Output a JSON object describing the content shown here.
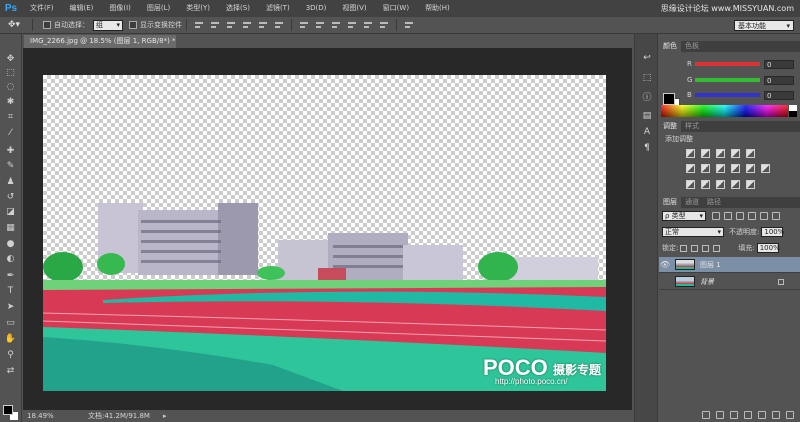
{
  "app": {
    "logo": "Ps",
    "accent": "#31a8ff"
  },
  "menu": {
    "items": [
      "文件(F)",
      "编辑(E)",
      "图像(I)",
      "图层(L)",
      "类型(Y)",
      "选择(S)",
      "滤镜(T)",
      "3D(D)",
      "视图(V)",
      "窗口(W)",
      "帮助(H)"
    ],
    "watermark": "思缘设计论坛 www.MISSYUAN.com"
  },
  "options": {
    "tool_icon": "move-tool-icon",
    "auto_select_label": "自动选择：",
    "auto_select_value": "组",
    "show_transform_label": "显示变换控件",
    "workspace": "基本功能"
  },
  "document": {
    "tab_title": "IMG_2266.jpg @ 18.5% (图层 1, RGB/8*) *",
    "watermark_brand": "POCO",
    "watermark_topic": "摄影专题",
    "watermark_url": "http://photo.poco.cn/"
  },
  "status": {
    "zoom": "18.49%",
    "doc_size": "文档:41.2M/91.8M"
  },
  "panels": {
    "color": {
      "tabs": [
        "颜色",
        "色板"
      ],
      "sliders": [
        {
          "letter": "R",
          "value": "0",
          "color": "#d33"
        },
        {
          "letter": "G",
          "value": "0",
          "color": "#3b3"
        },
        {
          "letter": "B",
          "value": "0",
          "color": "#33c"
        }
      ]
    },
    "adjustments": {
      "tabs": [
        "调整",
        "样式"
      ],
      "heading": "添加调整"
    },
    "layers": {
      "tabs": [
        "图层",
        "通道",
        "路径"
      ],
      "filter_kind": "ρ 类型",
      "blend_mode": "正常",
      "opacity_label": "不透明度:",
      "opacity_value": "100%",
      "lock_label": "锁定:",
      "fill_label": "填充:",
      "fill_value": "100%",
      "items": [
        {
          "name": "图层 1",
          "selected": true
        },
        {
          "name": "背景",
          "selected": false
        }
      ]
    }
  }
}
